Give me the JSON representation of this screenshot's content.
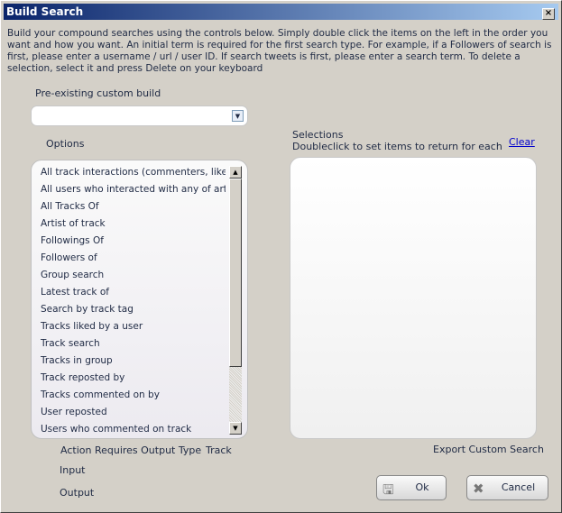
{
  "window": {
    "title": "Build Search",
    "close": "×"
  },
  "description": "Build your compound searches using the controls below. Simply double click the items on the left in the order you want and how you want.  An initial term is required for the first search type. For example, if a Followers of search is first, please enter a username / url  / user ID. If search tweets is first, please enter a search term. To delete a selection, select it and press Delete on your keyboard",
  "preexisting": {
    "label": "Pre-existing custom build",
    "value": ""
  },
  "options": {
    "label": "Options",
    "items": [
      "All track interactions (commenters, like...",
      "All users who interacted with any of art...",
      "All Tracks Of",
      "Artist of track",
      "Followings Of",
      "Followers of",
      "Group search",
      "Latest track of",
      "Search by track tag",
      "Tracks liked by a user",
      "Track search",
      "Tracks in group",
      "Track reposted by",
      "Tracks commented on by",
      "User reposted",
      "Users who commented on track"
    ]
  },
  "selections": {
    "label": "Selections",
    "hint": "Doubleclick to set items to return for each",
    "clear": "Clear"
  },
  "action": {
    "label": "Action Requires Output Type",
    "value": "Track",
    "input": "Input",
    "output": "Output"
  },
  "export": "Export Custom Search",
  "buttons": {
    "ok": "Ok",
    "cancel": "Cancel"
  }
}
